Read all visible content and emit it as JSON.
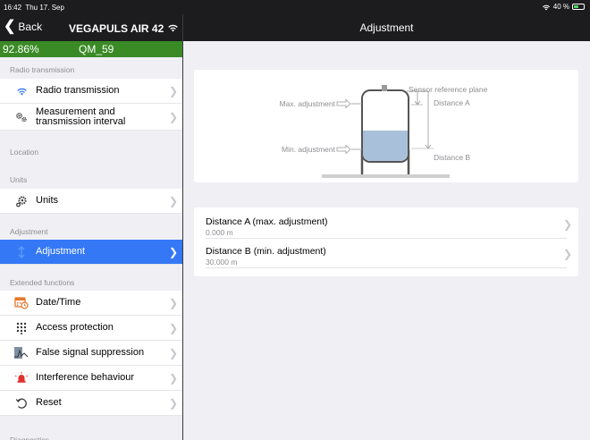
{
  "status": {
    "time": "16:42",
    "date": "Thu 17. Sep",
    "battery": "40 %"
  },
  "header": {
    "back_label": "Back",
    "device": "VEGAPULS AIR 42",
    "title": "Adjustment"
  },
  "device_status": {
    "value": "92.86%",
    "tag": "QM_59"
  },
  "sidebar": {
    "sections": {
      "radio": "Radio transmission",
      "location": "Location",
      "units": "Units",
      "adjustment": "Adjustment",
      "extended": "Extended functions",
      "diagnostics": "Diagnostics"
    },
    "items": {
      "radio": "Radio transmission",
      "measurement_line1": "Measurement and",
      "measurement_line2": "transmission interval",
      "units": "Units",
      "adjustment": "Adjustment",
      "datetime": "Date/Time",
      "access": "Access protection",
      "false_signal": "False signal suppression",
      "interference": "Interference behaviour",
      "reset": "Reset"
    }
  },
  "diagram": {
    "max_adjustment": "Max. adjustment",
    "min_adjustment": "Min. adjustment",
    "sensor_reference": "Sensor reference plane",
    "distance_a": "Distance A",
    "distance_b": "Distance B"
  },
  "adjustment_list": {
    "a_title": "Distance A (max. adjustment)",
    "a_value": "0.000 m",
    "b_title": "Distance B (min. adjustment)",
    "b_value": "30.000 m"
  },
  "colors": {
    "accent": "#3478f6",
    "status_green": "#3a8a25",
    "header_bg": "#1c1c1e"
  }
}
